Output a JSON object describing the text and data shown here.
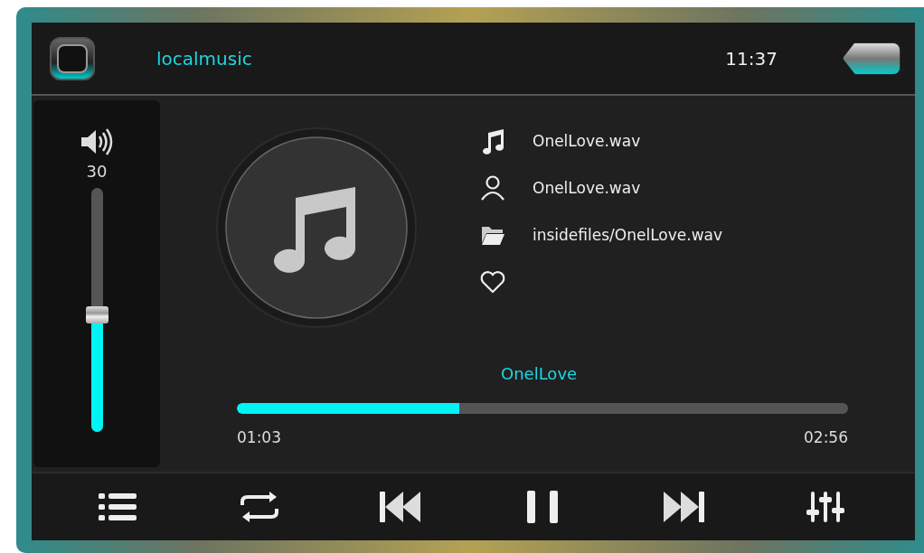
{
  "header": {
    "title": "localmusic",
    "time": "11:37"
  },
  "volume": {
    "value": "30",
    "level": 0.48
  },
  "track_info": [
    {
      "kind": "title",
      "text": "OnelLove.wav"
    },
    {
      "kind": "artist",
      "text": "OnelLove.wav"
    },
    {
      "kind": "folder",
      "text": "insidefiles/OnelLove.wav"
    },
    {
      "kind": "favorite",
      "favorite": false
    }
  ],
  "now_playing": "OnelLove",
  "progress": {
    "level": 0.364,
    "elapsed": "01:03",
    "duration": "02:56"
  },
  "controls": [
    {
      "kind": "playlist"
    },
    {
      "kind": "repeat"
    },
    {
      "kind": "previous"
    },
    {
      "kind": "pause"
    },
    {
      "kind": "next"
    },
    {
      "kind": "equalizer"
    }
  ]
}
